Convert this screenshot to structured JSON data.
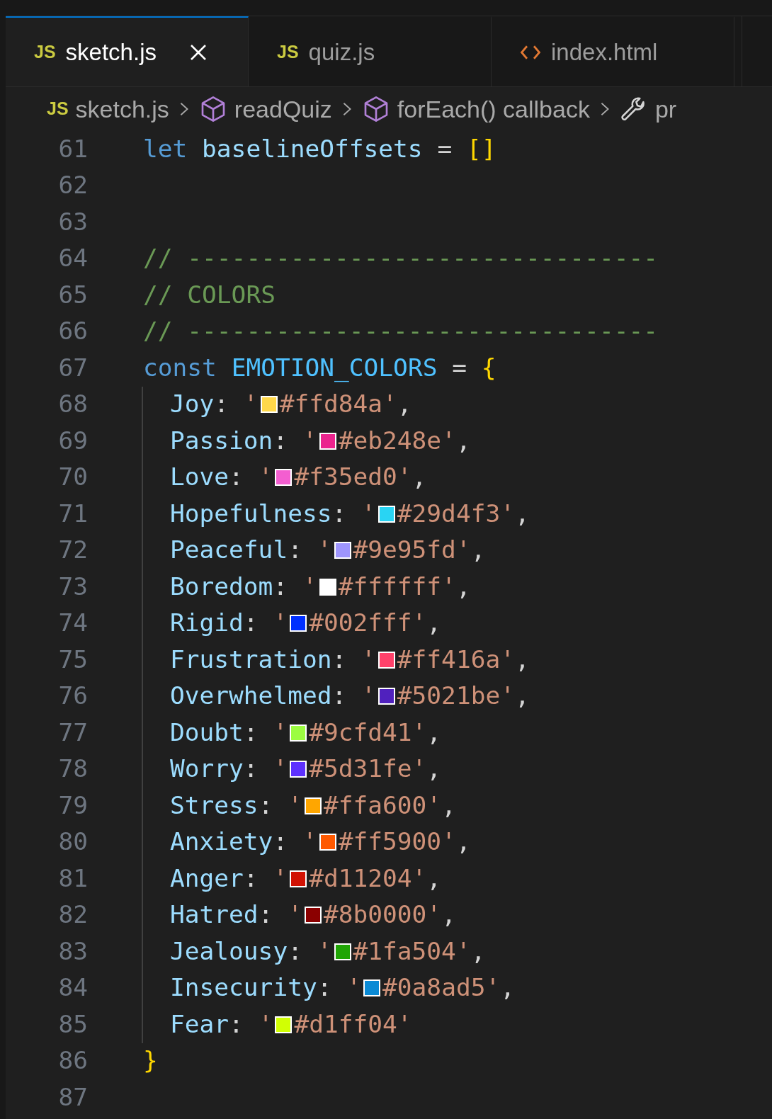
{
  "tabs": [
    {
      "label": "sketch.js",
      "kind": "js",
      "icon_text": "JS",
      "selected": true
    },
    {
      "label": "quiz.js",
      "kind": "js",
      "icon_text": "JS",
      "selected": false
    },
    {
      "label": "index.html",
      "kind": "html",
      "selected": false
    }
  ],
  "breadcrumbs": [
    {
      "label": "sketch.js",
      "kind": "file",
      "icon_text": "JS"
    },
    {
      "label": "readQuiz",
      "kind": "symbol"
    },
    {
      "label": "forEach() callback",
      "kind": "symbol"
    },
    {
      "label": "pr",
      "kind": "property"
    }
  ],
  "lines": [
    {
      "number": "61",
      "indented": false,
      "tokens": [
        {
          "kind": "keyword",
          "text": "let"
        },
        {
          "kind": "variable",
          "text": " baselineOffsets"
        },
        {
          "kind": "op",
          "text": " = "
        },
        {
          "kind": "bracket",
          "text": "[]"
        }
      ]
    },
    {
      "number": "62",
      "indented": false
    },
    {
      "number": "63",
      "indented": false
    },
    {
      "number": "64",
      "indented": false,
      "tokens": [
        {
          "kind": "comment",
          "text": "// --------------------------------"
        }
      ]
    },
    {
      "number": "65",
      "indented": false,
      "tokens": [
        {
          "kind": "comment",
          "text": "// COLORS"
        }
      ]
    },
    {
      "number": "66",
      "indented": false,
      "tokens": [
        {
          "kind": "comment",
          "text": "// --------------------------------"
        }
      ]
    },
    {
      "number": "67",
      "indented": false,
      "tokens": [
        {
          "kind": "keyword",
          "text": "const"
        },
        {
          "kind": "constant",
          "text": " EMOTION_COLORS"
        },
        {
          "kind": "op",
          "text": " = "
        },
        {
          "kind": "bracket",
          "text": "{"
        }
      ]
    },
    {
      "number": "68",
      "indented": true,
      "tokens": [
        {
          "kind": "property",
          "text": "Joy"
        },
        {
          "kind": "op",
          "text": ": "
        },
        {
          "kind": "string",
          "text": "'"
        },
        {
          "kind": "swatch",
          "color": "#ffd84a"
        },
        {
          "kind": "string",
          "text": "#ffd84a'"
        },
        {
          "kind": "op",
          "text": ","
        }
      ]
    },
    {
      "number": "69",
      "indented": true,
      "tokens": [
        {
          "kind": "property",
          "text": "Passion"
        },
        {
          "kind": "op",
          "text": ": "
        },
        {
          "kind": "string",
          "text": "'"
        },
        {
          "kind": "swatch",
          "color": "#eb248e"
        },
        {
          "kind": "string",
          "text": "#eb248e'"
        },
        {
          "kind": "op",
          "text": ","
        }
      ]
    },
    {
      "number": "70",
      "indented": true,
      "tokens": [
        {
          "kind": "property",
          "text": "Love"
        },
        {
          "kind": "op",
          "text": ": "
        },
        {
          "kind": "string",
          "text": "'"
        },
        {
          "kind": "swatch",
          "color": "#f35ed0"
        },
        {
          "kind": "string",
          "text": "#f35ed0'"
        },
        {
          "kind": "op",
          "text": ","
        }
      ]
    },
    {
      "number": "71",
      "indented": true,
      "tokens": [
        {
          "kind": "property",
          "text": "Hopefulness"
        },
        {
          "kind": "op",
          "text": ": "
        },
        {
          "kind": "string",
          "text": "'"
        },
        {
          "kind": "swatch",
          "color": "#29d4f3"
        },
        {
          "kind": "string",
          "text": "#29d4f3'"
        },
        {
          "kind": "op",
          "text": ","
        }
      ]
    },
    {
      "number": "72",
      "indented": true,
      "tokens": [
        {
          "kind": "property",
          "text": "Peaceful"
        },
        {
          "kind": "op",
          "text": ": "
        },
        {
          "kind": "string",
          "text": "'"
        },
        {
          "kind": "swatch",
          "color": "#9e95fd"
        },
        {
          "kind": "string",
          "text": "#9e95fd'"
        },
        {
          "kind": "op",
          "text": ","
        }
      ]
    },
    {
      "number": "73",
      "indented": true,
      "tokens": [
        {
          "kind": "property",
          "text": "Boredom"
        },
        {
          "kind": "op",
          "text": ": "
        },
        {
          "kind": "string",
          "text": "'"
        },
        {
          "kind": "swatch",
          "color": "#ffffff"
        },
        {
          "kind": "string",
          "text": "#ffffff'"
        },
        {
          "kind": "op",
          "text": ","
        }
      ]
    },
    {
      "number": "74",
      "indented": true,
      "tokens": [
        {
          "kind": "property",
          "text": "Rigid"
        },
        {
          "kind": "op",
          "text": ": "
        },
        {
          "kind": "string",
          "text": "'"
        },
        {
          "kind": "swatch",
          "color": "#002fff"
        },
        {
          "kind": "string",
          "text": "#002fff'"
        },
        {
          "kind": "op",
          "text": ","
        }
      ]
    },
    {
      "number": "75",
      "indented": true,
      "tokens": [
        {
          "kind": "property",
          "text": "Frustration"
        },
        {
          "kind": "op",
          "text": ": "
        },
        {
          "kind": "string",
          "text": "'"
        },
        {
          "kind": "swatch",
          "color": "#ff416a"
        },
        {
          "kind": "string",
          "text": "#ff416a'"
        },
        {
          "kind": "op",
          "text": ","
        }
      ]
    },
    {
      "number": "76",
      "indented": true,
      "tokens": [
        {
          "kind": "property",
          "text": "Overwhelmed"
        },
        {
          "kind": "op",
          "text": ": "
        },
        {
          "kind": "string",
          "text": "'"
        },
        {
          "kind": "swatch",
          "color": "#5021be"
        },
        {
          "kind": "string",
          "text": "#5021be'"
        },
        {
          "kind": "op",
          "text": ","
        }
      ]
    },
    {
      "number": "77",
      "indented": true,
      "tokens": [
        {
          "kind": "property",
          "text": "Doubt"
        },
        {
          "kind": "op",
          "text": ": "
        },
        {
          "kind": "string",
          "text": "'"
        },
        {
          "kind": "swatch",
          "color": "#9cfd41"
        },
        {
          "kind": "string",
          "text": "#9cfd41'"
        },
        {
          "kind": "op",
          "text": ","
        }
      ]
    },
    {
      "number": "78",
      "indented": true,
      "tokens": [
        {
          "kind": "property",
          "text": "Worry"
        },
        {
          "kind": "op",
          "text": ": "
        },
        {
          "kind": "string",
          "text": "'"
        },
        {
          "kind": "swatch",
          "color": "#5d31fe"
        },
        {
          "kind": "string",
          "text": "#5d31fe'"
        },
        {
          "kind": "op",
          "text": ","
        }
      ]
    },
    {
      "number": "79",
      "indented": true,
      "tokens": [
        {
          "kind": "property",
          "text": "Stress"
        },
        {
          "kind": "op",
          "text": ": "
        },
        {
          "kind": "string",
          "text": "'"
        },
        {
          "kind": "swatch",
          "color": "#ffa600"
        },
        {
          "kind": "string",
          "text": "#ffa600'"
        },
        {
          "kind": "op",
          "text": ","
        }
      ]
    },
    {
      "number": "80",
      "indented": true,
      "tokens": [
        {
          "kind": "property",
          "text": "Anxiety"
        },
        {
          "kind": "op",
          "text": ": "
        },
        {
          "kind": "string",
          "text": "'"
        },
        {
          "kind": "swatch",
          "color": "#ff5900"
        },
        {
          "kind": "string",
          "text": "#ff5900'"
        },
        {
          "kind": "op",
          "text": ","
        }
      ]
    },
    {
      "number": "81",
      "indented": true,
      "tokens": [
        {
          "kind": "property",
          "text": "Anger"
        },
        {
          "kind": "op",
          "text": ": "
        },
        {
          "kind": "string",
          "text": "'"
        },
        {
          "kind": "swatch",
          "color": "#d11204"
        },
        {
          "kind": "string",
          "text": "#d11204'"
        },
        {
          "kind": "op",
          "text": ","
        }
      ]
    },
    {
      "number": "82",
      "indented": true,
      "tokens": [
        {
          "kind": "property",
          "text": "Hatred"
        },
        {
          "kind": "op",
          "text": ": "
        },
        {
          "kind": "string",
          "text": "'"
        },
        {
          "kind": "swatch",
          "color": "#8b0000"
        },
        {
          "kind": "string",
          "text": "#8b0000'"
        },
        {
          "kind": "op",
          "text": ","
        }
      ]
    },
    {
      "number": "83",
      "indented": true,
      "tokens": [
        {
          "kind": "property",
          "text": "Jealousy"
        },
        {
          "kind": "op",
          "text": ": "
        },
        {
          "kind": "string",
          "text": "'"
        },
        {
          "kind": "swatch",
          "color": "#1fa504"
        },
        {
          "kind": "string",
          "text": "#1fa504'"
        },
        {
          "kind": "op",
          "text": ","
        }
      ]
    },
    {
      "number": "84",
      "indented": true,
      "tokens": [
        {
          "kind": "property",
          "text": "Insecurity"
        },
        {
          "kind": "op",
          "text": ": "
        },
        {
          "kind": "string",
          "text": "'"
        },
        {
          "kind": "swatch",
          "color": "#0a8ad5"
        },
        {
          "kind": "string",
          "text": "#0a8ad5'"
        },
        {
          "kind": "op",
          "text": ","
        }
      ]
    },
    {
      "number": "85",
      "indented": true,
      "tokens": [
        {
          "kind": "property",
          "text": "Fear"
        },
        {
          "kind": "op",
          "text": ": "
        },
        {
          "kind": "string",
          "text": "'"
        },
        {
          "kind": "swatch",
          "color": "#d1ff04"
        },
        {
          "kind": "string",
          "text": "#d1ff04'"
        }
      ]
    },
    {
      "number": "86",
      "indented": false,
      "tokens": [
        {
          "kind": "bracket",
          "text": "}"
        }
      ]
    },
    {
      "number": "87",
      "indented": false
    }
  ]
}
